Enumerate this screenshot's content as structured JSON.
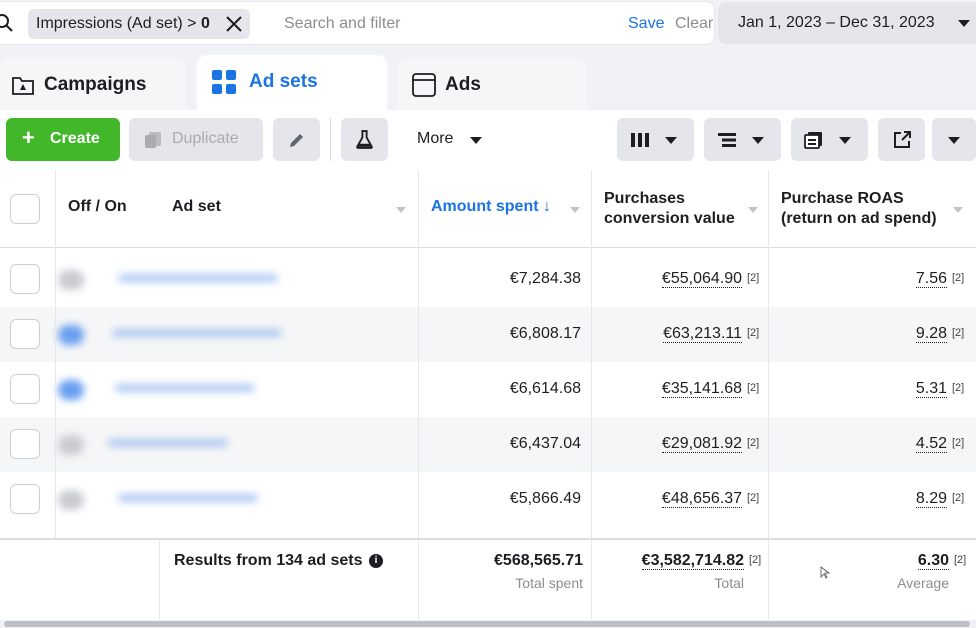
{
  "filter": {
    "chip_text": "Impressions (Ad set) > ",
    "chip_value": "0",
    "search_placeholder": "Search and filter",
    "save_label": "Save",
    "clear_label": "Clear"
  },
  "date_range": "Jan 1, 2023 – Dec 31, 2023",
  "tabs": [
    {
      "label": "Campaigns",
      "icon": "campaign-folder-icon",
      "active": false
    },
    {
      "label": "Ad sets",
      "icon": "ad-sets-grid-icon",
      "active": true
    },
    {
      "label": "Ads",
      "icon": "ads-window-icon",
      "active": false
    }
  ],
  "toolbar": {
    "create_label": "Create",
    "duplicate_label": "Duplicate",
    "more_label": "More",
    "icons": [
      "edit-pencil-icon",
      "test-flask-icon",
      "columns-icon",
      "breakdown-icon",
      "reports-icon",
      "export-icon"
    ]
  },
  "columns": {
    "off_on": "Off / On",
    "ad_set": "Ad set",
    "amount_spent": "Amount spent ↓",
    "purchases_value": "Purchases conversion value",
    "purchase_roas": "Purchase ROAS (return on ad spend)"
  },
  "rows": [
    {
      "amount_spent": "€7,284.38",
      "purchases_value": "€55,064.90",
      "pv_note": "[2]",
      "roas": "7.56",
      "roas_note": "[2]"
    },
    {
      "amount_spent": "€6,808.17",
      "purchases_value": "€63,213.11",
      "pv_note": "[2]",
      "roas": "9.28",
      "roas_note": "[2]"
    },
    {
      "amount_spent": "€6,614.68",
      "purchases_value": "€35,141.68",
      "pv_note": "[2]",
      "roas": "5.31",
      "roas_note": "[2]"
    },
    {
      "amount_spent": "€6,437.04",
      "purchases_value": "€29,081.92",
      "pv_note": "[2]",
      "roas": "4.52",
      "roas_note": "[2]"
    },
    {
      "amount_spent": "€5,866.49",
      "purchases_value": "€48,656.37",
      "pv_note": "[2]",
      "roas": "8.29",
      "roas_note": "[2]"
    }
  ],
  "totals": {
    "label": "Results from 134 ad sets",
    "amount_spent": "€568,565.71",
    "amount_spent_sub": "Total spent",
    "purchases_value": "€3,582,714.82",
    "pv_note": "[2]",
    "purchases_value_sub": "Total",
    "roas": "6.30",
    "roas_note": "[2]",
    "roas_sub": "Average"
  },
  "colors": {
    "accent": "#1b74e4",
    "create_green": "#42b72a"
  }
}
